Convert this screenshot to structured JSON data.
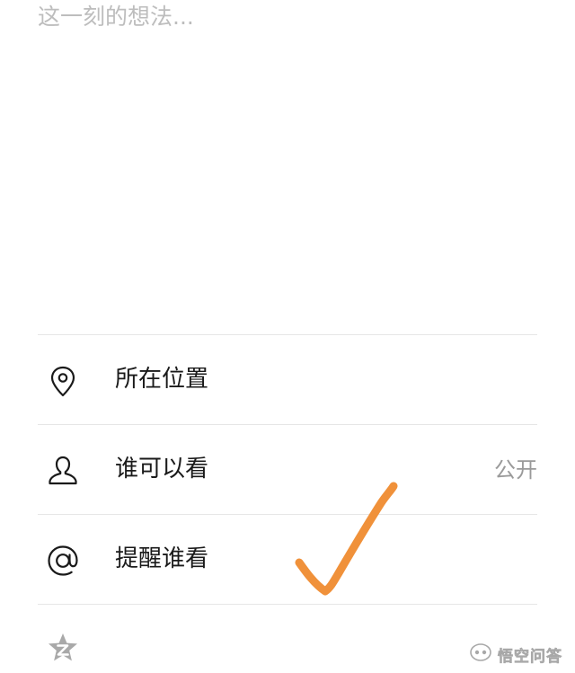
{
  "compose": {
    "placeholder": "这一刻的想法..."
  },
  "options": [
    {
      "label": "所在位置",
      "value": "",
      "icon": "location-pin-icon"
    },
    {
      "label": "谁可以看",
      "value": "公开",
      "icon": "person-icon"
    },
    {
      "label": "提醒谁看",
      "value": "",
      "icon": "at-sign-icon"
    }
  ],
  "toolbar": {
    "icon": "star-z-icon"
  },
  "annotation": {
    "mark": "checkmark",
    "color": "#f0913a"
  },
  "watermark": {
    "text": "悟空问答",
    "icon": "wukong-logo-icon"
  },
  "colors": {
    "placeholder": "#bdbdbd",
    "divider": "#e6e6e6",
    "secondary_text": "#9a9a9a"
  }
}
